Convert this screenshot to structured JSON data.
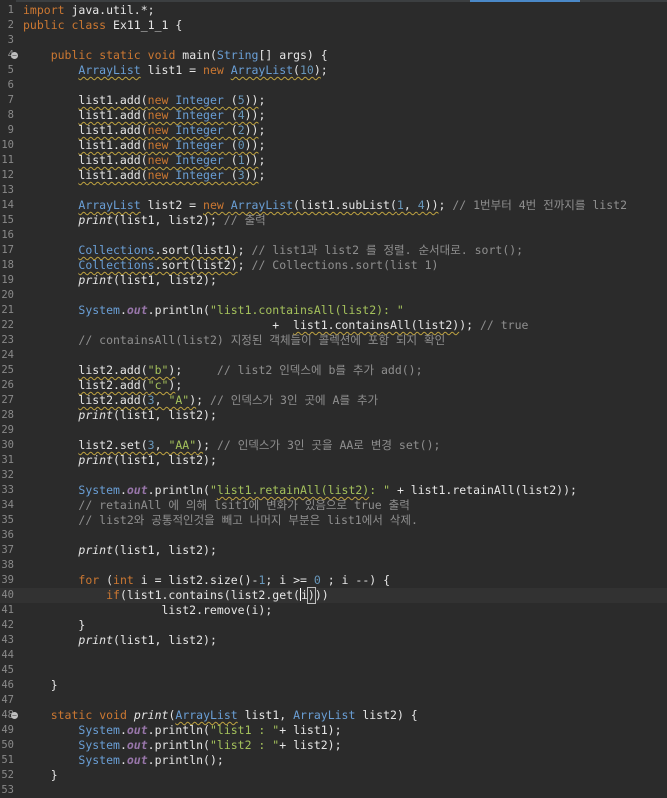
{
  "editor": {
    "lines": [
      {
        "n": "1",
        "t": "import java.util.*;"
      },
      {
        "n": "2",
        "t": "public class Ex11_1_1 {"
      },
      {
        "n": "3",
        "t": ""
      },
      {
        "n": "4",
        "t": "    public static void main(String[] args) {",
        "fold": true
      },
      {
        "n": "5",
        "t": "        ArrayList list1 = new ArrayList(10);"
      },
      {
        "n": "6",
        "t": ""
      },
      {
        "n": "7",
        "t": "        list1.add(new Integer (5));"
      },
      {
        "n": "8",
        "t": "        list1.add(new Integer (4));"
      },
      {
        "n": "9",
        "t": "        list1.add(new Integer (2));"
      },
      {
        "n": "10",
        "t": "        list1.add(new Integer (0));"
      },
      {
        "n": "11",
        "t": "        list1.add(new Integer (1));"
      },
      {
        "n": "12",
        "t": "        list1.add(new Integer (3));"
      },
      {
        "n": "13",
        "t": ""
      },
      {
        "n": "14",
        "t": "        ArrayList list2 = new ArrayList(list1.subList(1, 4)); // 1번부터 4번 전까지를 list2"
      },
      {
        "n": "15",
        "t": "        print(list1, list2); // 출력"
      },
      {
        "n": "16",
        "t": ""
      },
      {
        "n": "17",
        "t": "        Collections.sort(list1); // list1과 list2 를 정렬. 순서대로. sort();"
      },
      {
        "n": "18",
        "t": "        Collections.sort(list2); // Collections.sort(list 1)"
      },
      {
        "n": "19",
        "t": "        print(list1, list2);"
      },
      {
        "n": "20",
        "t": ""
      },
      {
        "n": "21",
        "t": "        System.out.println(\"list1.containsAll(list2): \""
      },
      {
        "n": "22",
        "t": "                                    +  list1.containsAll(list2)); // true"
      },
      {
        "n": "23",
        "t": "        // containsAll(list2) 지정된 객체들이 콜렉션에 포함 되지 확인"
      },
      {
        "n": "24",
        "t": ""
      },
      {
        "n": "25",
        "t": "        list2.add(\"b\");     // list2 인덱스에 b를 추가 add();"
      },
      {
        "n": "26",
        "t": "        list2.add(\"c\");"
      },
      {
        "n": "27",
        "t": "        list2.add(3, \"A\"); // 인덱스가 3인 곳에 A를 추가"
      },
      {
        "n": "28",
        "t": "        print(list1, list2);"
      },
      {
        "n": "29",
        "t": ""
      },
      {
        "n": "30",
        "t": "        list2.set(3, \"AA\"); // 인덱스가 3인 곳을 AA로 변경 set();"
      },
      {
        "n": "31",
        "t": "        print(list1, list2);"
      },
      {
        "n": "32",
        "t": ""
      },
      {
        "n": "33",
        "t": "        System.out.println(\"list1.retainAll(list2): \" + list1.retainAll(list2));"
      },
      {
        "n": "34",
        "t": "        // retainAll 에 의해 lsit1에 변화가 있음으로 true 출력"
      },
      {
        "n": "35",
        "t": "        // list2와 공통적인것을 빼고 나머지 부분은 list1에서 삭제."
      },
      {
        "n": "36",
        "t": ""
      },
      {
        "n": "37",
        "t": "        print(list1, list2);"
      },
      {
        "n": "38",
        "t": ""
      },
      {
        "n": "39",
        "t": "        for (int i = list2.size()-1; i >= 0 ; i --) {"
      },
      {
        "n": "40",
        "t": "            if(list1.contains(list2.get(i)))",
        "current": true
      },
      {
        "n": "41",
        "t": "                    list2.remove(i);"
      },
      {
        "n": "42",
        "t": "        }"
      },
      {
        "n": "43",
        "t": "        print(list1, list2);"
      },
      {
        "n": "44",
        "t": ""
      },
      {
        "n": "45",
        "t": ""
      },
      {
        "n": "46",
        "t": "    }"
      },
      {
        "n": "47",
        "t": ""
      },
      {
        "n": "48",
        "t": "    static void print(ArrayList list1, ArrayList list2) {",
        "fold": true
      },
      {
        "n": "49",
        "t": "        System.out.println(\"list1 : \"+ list1);"
      },
      {
        "n": "50",
        "t": "        System.out.println(\"list2 : \"+ list2);"
      },
      {
        "n": "51",
        "t": "        System.out.println();"
      },
      {
        "n": "52",
        "t": "    }"
      },
      {
        "n": "53",
        "t": ""
      }
    ]
  },
  "colors": {
    "background": "#2b2b2b",
    "keyword": "#cc7832",
    "type": "#6a9fd6",
    "field": "#9876aa",
    "string": "#a5c25c",
    "number": "#6897bb",
    "comment": "#8f8f8f",
    "warning_underline": "#bfa341",
    "current_line": "#323232"
  },
  "icons": {
    "fold": "fold-collapse-icon"
  }
}
